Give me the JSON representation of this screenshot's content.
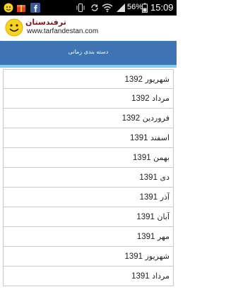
{
  "status_bar": {
    "battery_percent": "56%",
    "time": "15:09",
    "icons": [
      "app-logo-icon",
      "gift-icon",
      "facebook-icon",
      "vibrate-icon",
      "sync-icon",
      "wifi-icon",
      "signal-icon",
      "battery-icon"
    ]
  },
  "app": {
    "title": "ترفندستان",
    "url": "www.tarfandestan.com"
  },
  "page": {
    "title": "دسته بندی زمانی"
  },
  "list": {
    "items": [
      {
        "month": "شهریور",
        "year": "1392"
      },
      {
        "month": "مرداد",
        "year": "1392"
      },
      {
        "month": "فروردین",
        "year": "1392"
      },
      {
        "month": "اسفند",
        "year": "1391"
      },
      {
        "month": "بهمن",
        "year": "1391"
      },
      {
        "month": "دی",
        "year": "1391"
      },
      {
        "month": "آذر",
        "year": "1391"
      },
      {
        "month": "آبان",
        "year": "1391"
      },
      {
        "month": "مهر",
        "year": "1391"
      },
      {
        "month": "شهریور",
        "year": "1391"
      },
      {
        "month": "مرداد",
        "year": "1391"
      }
    ]
  },
  "colors": {
    "titlebar": "#3f74b4",
    "accent": "#7fd0f0",
    "status_bar": "#000000"
  }
}
